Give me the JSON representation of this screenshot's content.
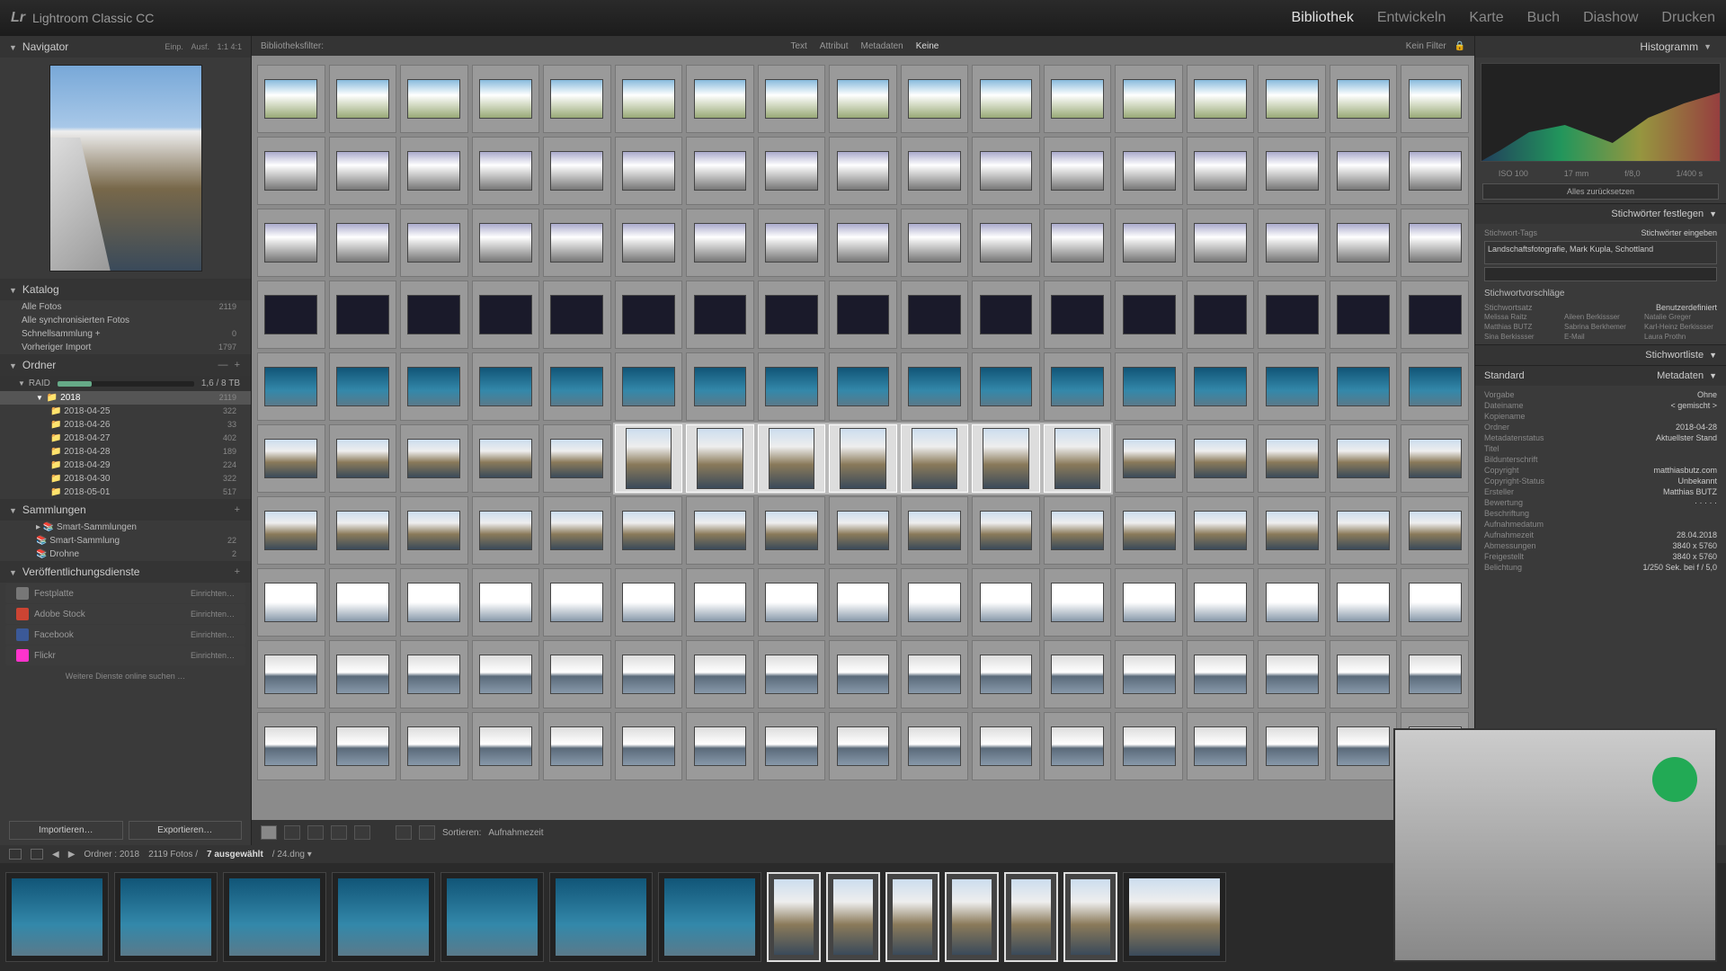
{
  "app": {
    "logo": "Lr",
    "name": "Lightroom Classic CC"
  },
  "modules": {
    "library": "Bibliothek",
    "develop": "Entwickeln",
    "map": "Karte",
    "book": "Buch",
    "slideshow": "Diashow",
    "print": "Drucken"
  },
  "navigator": {
    "title": "Navigator",
    "fit": "Einp.",
    "fill": "Ausf.",
    "ratios": "1:1   4:1"
  },
  "catalog": {
    "title": "Katalog",
    "items": [
      {
        "label": "Alle Fotos",
        "count": "2119"
      },
      {
        "label": "Alle synchronisierten Fotos",
        "count": ""
      },
      {
        "label": "Schnellsammlung  +",
        "count": "0"
      },
      {
        "label": "Vorheriger Import",
        "count": "1797"
      }
    ]
  },
  "folders": {
    "title": "Ordner",
    "volume": "RAID",
    "volume_free": "1,6 / 8 TB",
    "root": {
      "label": "2018",
      "count": "2119"
    },
    "dates": [
      {
        "label": "2018-04-25",
        "count": "322"
      },
      {
        "label": "2018-04-26",
        "count": "33"
      },
      {
        "label": "2018-04-27",
        "count": "402"
      },
      {
        "label": "2018-04-28",
        "count": "189"
      },
      {
        "label": "2018-04-29",
        "count": "224"
      },
      {
        "label": "2018-04-30",
        "count": "322"
      },
      {
        "label": "2018-05-01",
        "count": "517"
      }
    ]
  },
  "collections": {
    "title": "Sammlungen",
    "items": [
      {
        "label": "Smart-Sammlungen",
        "count": ""
      },
      {
        "label": "Smart-Sammlung",
        "count": "22"
      },
      {
        "label": "Drohne",
        "count": "2"
      }
    ]
  },
  "publish": {
    "title": "Veröffentlichungsdienste",
    "items": [
      {
        "label": "Festplatte",
        "action": "Einrichten…",
        "color": "#777"
      },
      {
        "label": "Adobe Stock",
        "action": "Einrichten…",
        "color": "#c43"
      },
      {
        "label": "Facebook",
        "action": "Einrichten…",
        "color": "#3b5998"
      },
      {
        "label": "Flickr",
        "action": "Einrichten…",
        "color": "#f3c"
      }
    ],
    "more": "Weitere Dienste online suchen …"
  },
  "buttons": {
    "import": "Importieren…",
    "export": "Exportieren…"
  },
  "filterbar": {
    "title": "Bibliotheksfilter:",
    "text": "Text",
    "attribute": "Attribut",
    "metadata": "Metadaten",
    "none": "Keine",
    "nofilter": "Kein Filter"
  },
  "toolbar": {
    "sort_label": "Sortieren:",
    "sort_value": "Aufnahmezeit"
  },
  "statusbar": {
    "path": "Ordner : 2018",
    "count": "2119 Fotos /",
    "selected": "7 ausgewählt",
    "format": "/ 24.dng  ▾"
  },
  "right": {
    "histogram_title": "Histogramm",
    "histo_meta": {
      "iso": "ISO 100",
      "focal": "17 mm",
      "ap": "f/8,0",
      "sh": "1/400 s"
    },
    "reset": "Alles zurücksetzen",
    "keywording": {
      "title": "Stichwörter festlegen",
      "tags_label": "Stichwort-Tags",
      "tags_mode": "Stichwörter eingeben",
      "tags_value": "Landschaftsfotografie, Mark Kupla, Schottland",
      "suggest_title": "Stichwortvorschläge",
      "set_label": "Stichwortsatz",
      "set_value": "Benutzerdefiniert",
      "suggestions": [
        "Melissa Raitz",
        "Aileen Berkissser",
        "Natalie Greger",
        "Matthias BUTZ",
        "Sabrina Berkhemer",
        "Karl-Heinz Berkissser",
        "Sina Berkissser",
        "E-Mail",
        "Laura Prothn"
      ]
    },
    "keywordlist_title": "Stichwortliste",
    "metadata": {
      "title": "Metadaten",
      "preset_label": "Standard",
      "preset_menu": "Metadaten",
      "rows": [
        {
          "k": "Vorgabe",
          "v": "Ohne"
        },
        {
          "k": "Dateiname",
          "v": "< gemischt >"
        },
        {
          "k": "Kopiename",
          "v": ""
        },
        {
          "k": "Ordner",
          "v": "2018-04-28"
        },
        {
          "k": "Metadatenstatus",
          "v": "Aktuellster Stand"
        },
        {
          "k": "Titel",
          "v": ""
        },
        {
          "k": "Bildunterschrift",
          "v": ""
        },
        {
          "k": "Copyright",
          "v": "matthiasbutz.com"
        },
        {
          "k": "Copyright-Status",
          "v": "Unbekannt"
        },
        {
          "k": "Ersteller",
          "v": "Matthias BUTZ"
        },
        {
          "k": "Bewertung",
          "v": "·   ·   ·   ·   ·"
        },
        {
          "k": "Beschriftung",
          "v": ""
        },
        {
          "k": "Aufnahmedatum",
          "v": ""
        },
        {
          "k": "Aufnahmezeit",
          "v": "28.04.2018"
        },
        {
          "k": "Abmessungen",
          "v": "3840 x 5760"
        },
        {
          "k": "Freigestellt",
          "v": "3840 x 5760"
        },
        {
          "k": "Belichtung",
          "v": "1/250 Sek. bei f / 5,0"
        }
      ]
    }
  },
  "grid": {
    "selected_row": 5,
    "selected_start": 5,
    "selected_end": 11,
    "row_styles": [
      "c-sky",
      "c-road",
      "c-road",
      "c-dark",
      "c-blue",
      "c-coast",
      "c-coast",
      "c-white",
      "c-reflect",
      "c-reflect"
    ]
  }
}
